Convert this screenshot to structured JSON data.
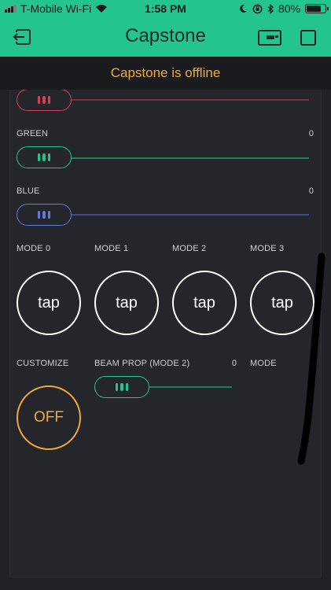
{
  "status_bar": {
    "carrier": "T-Mobile Wi-Fi",
    "time": "1:58 PM",
    "battery": "80%",
    "battery_fraction": 0.8
  },
  "nav": {
    "title": "Capstone",
    "back_icon": "exit-icon",
    "device_icon": "device-icon",
    "square_icon": "square-icon"
  },
  "banner": {
    "text": "Capstone is offline"
  },
  "colors": {
    "header_bg": "#23c48e",
    "red": "#d3435c",
    "green": "#23c48e",
    "blue": "#5f7cd8",
    "orange": "#f0a93b",
    "canvas_bg": "#25262b"
  },
  "sliders": {
    "red": {
      "label": "",
      "value": ""
    },
    "green": {
      "label": "GREEN",
      "value": "0"
    },
    "blue": {
      "label": "BLUE",
      "value": "0"
    }
  },
  "modes": [
    {
      "label": "MODE 0",
      "button": "tap"
    },
    {
      "label": "MODE 1",
      "button": "tap"
    },
    {
      "label": "MODE 2",
      "button": "tap"
    },
    {
      "label": "MODE 3",
      "button": "tap"
    }
  ],
  "customize": {
    "label": "CUSTOMIZE",
    "button": "OFF"
  },
  "beam": {
    "label": "BEAM PROP (MODE 2)",
    "value": "0"
  },
  "mode_label": "MODE"
}
